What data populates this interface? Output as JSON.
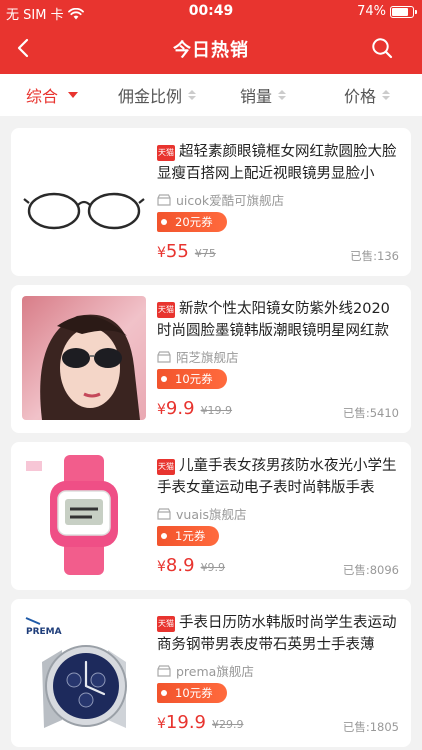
{
  "status": {
    "carrier": "无 SIM 卡",
    "time": "00:49",
    "battery": "74%",
    "battery_level": 0.74
  },
  "nav": {
    "title": "今日热销"
  },
  "sort": {
    "items": [
      "综合",
      "佣金比例",
      "销量",
      "价格"
    ]
  },
  "colors": {
    "brand": "#e8342f",
    "coupon": "#f2542d"
  },
  "tmall_badge": "天猫",
  "products": [
    {
      "title": "超轻素颜眼镜框女网红款圆脸大脸显瘦百搭网上配近视眼镜男显脸小",
      "shop": "uicok爱酷可旗舰店",
      "coupon": "20元券",
      "price_symbol": "¥",
      "price": "55",
      "orig": "¥75",
      "sold": "已售:136",
      "image": "glasses-icon"
    },
    {
      "title": "新款个性太阳镜女防紫外线2020时尚圆脸墨镜韩版潮眼镜明星网红款",
      "shop": "陌芝旗舰店",
      "coupon": "10元券",
      "price_symbol": "¥",
      "price": "9.9",
      "orig": "¥19.9",
      "sold": "已售:5410",
      "image": "sunglasses-model-photo"
    },
    {
      "title": "儿童手表女孩男孩防水夜光小学生手表女童运动电子表时尚韩版手表",
      "shop": "vuais旗舰店",
      "coupon": "1元券",
      "price_symbol": "¥",
      "price": "8.9",
      "orig": "¥9.9",
      "sold": "已售:8096",
      "image": "pink-watch-photo"
    },
    {
      "title": "手表日历防水韩版时尚学生表运动商务钢带男表皮带石英男士手表薄",
      "shop": "prema旗舰店",
      "coupon": "10元券",
      "price_symbol": "¥",
      "price": "19.9",
      "orig": "¥29.9",
      "sold": "已售:1805",
      "image": "steel-watch-photo",
      "brand_text": "PREMA"
    }
  ]
}
